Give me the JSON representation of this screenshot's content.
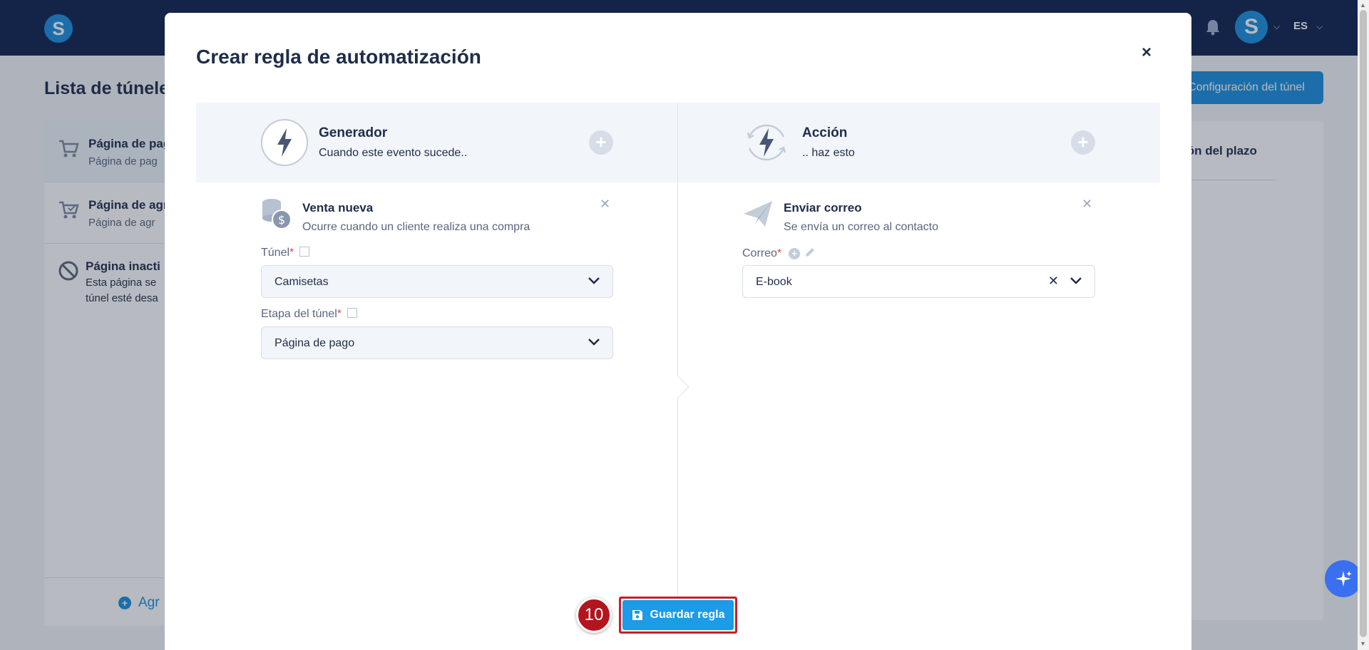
{
  "header": {
    "logo_letter": "S",
    "avatar_letter": "S",
    "language": "ES"
  },
  "page": {
    "title": "Lista de túnele",
    "config_button": "Configuración del túnel",
    "column_header": "ión del plazo"
  },
  "steps": [
    {
      "title": "Página de pag",
      "subtitle": "Página de pag"
    },
    {
      "title": "Página de agr",
      "subtitle": "Página de agr"
    },
    {
      "title": "Página inacti",
      "subtitle1": "Esta página se",
      "subtitle2": "túnel esté desa"
    }
  ],
  "add_step_label": "Agr",
  "modal": {
    "title": "Crear regla de automatización",
    "close_label": "×",
    "trigger": {
      "title": "Generador",
      "subtitle": "Cuando este evento sucede.."
    },
    "action": {
      "title": "Acción",
      "subtitle": ".. haz esto"
    },
    "trigger_card": {
      "title": "Venta nueva",
      "subtitle": "Ocurre cuando un cliente realiza una compra",
      "funnel_label": "Túnel",
      "funnel_value": "Camisetas",
      "stage_label": "Etapa del túnel",
      "stage_value": "Página de pago"
    },
    "action_card": {
      "title": "Enviar correo",
      "subtitle": "Se envía un correo al contacto",
      "email_label": "Correo",
      "email_value": "E-book"
    },
    "save_button": "Guardar regla"
  },
  "step_badge": "10"
}
